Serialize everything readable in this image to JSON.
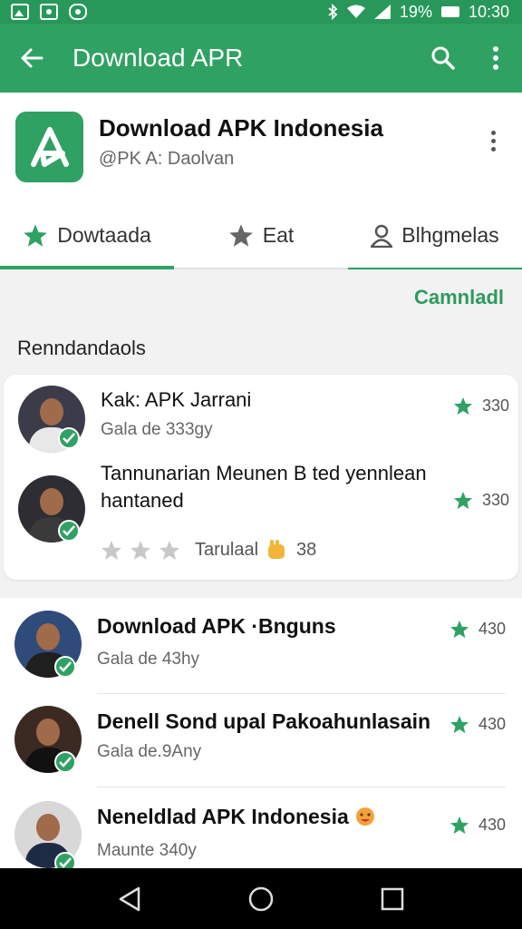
{
  "status_bar": {
    "battery": "19%",
    "time": "10:30"
  },
  "app_bar": {
    "title": "Download APR"
  },
  "app": {
    "name": "Download APK Indonesia",
    "developer": "@PK A: Daolvan"
  },
  "tabs": [
    {
      "label": "Dowtaada",
      "icon": "star-icon"
    },
    {
      "label": "Eat",
      "icon": "pin-star-icon"
    },
    {
      "label": "Blhgmelas",
      "icon": "person-icon"
    }
  ],
  "link_right": "Camnladl",
  "section_title": "Renndandaols",
  "featured": [
    {
      "title": "Kak: APK Jarrani",
      "subtitle": "Gala de 333gy",
      "rating": "330"
    },
    {
      "title": "Tannunarian Meunen B ted yennlean hantaned",
      "subtitle": "",
      "rating": "330"
    }
  ],
  "stars_row": {
    "label": "Tarulaal",
    "count": "38"
  },
  "list_items": [
    {
      "title": "Download APK ·Bnguns",
      "subtitle": "Gala de 43hy",
      "rating": "430"
    },
    {
      "title": "Denell Sond upal Pakoahunlasain",
      "subtitle": "Gala de.9Any",
      "rating": "430"
    },
    {
      "title": "Neneldlad APK Indonesia",
      "subtitle": "Maunte 340y",
      "rating": "430"
    }
  ],
  "colors": {
    "primary": "#2fa163",
    "status_bar": "#27985a"
  }
}
